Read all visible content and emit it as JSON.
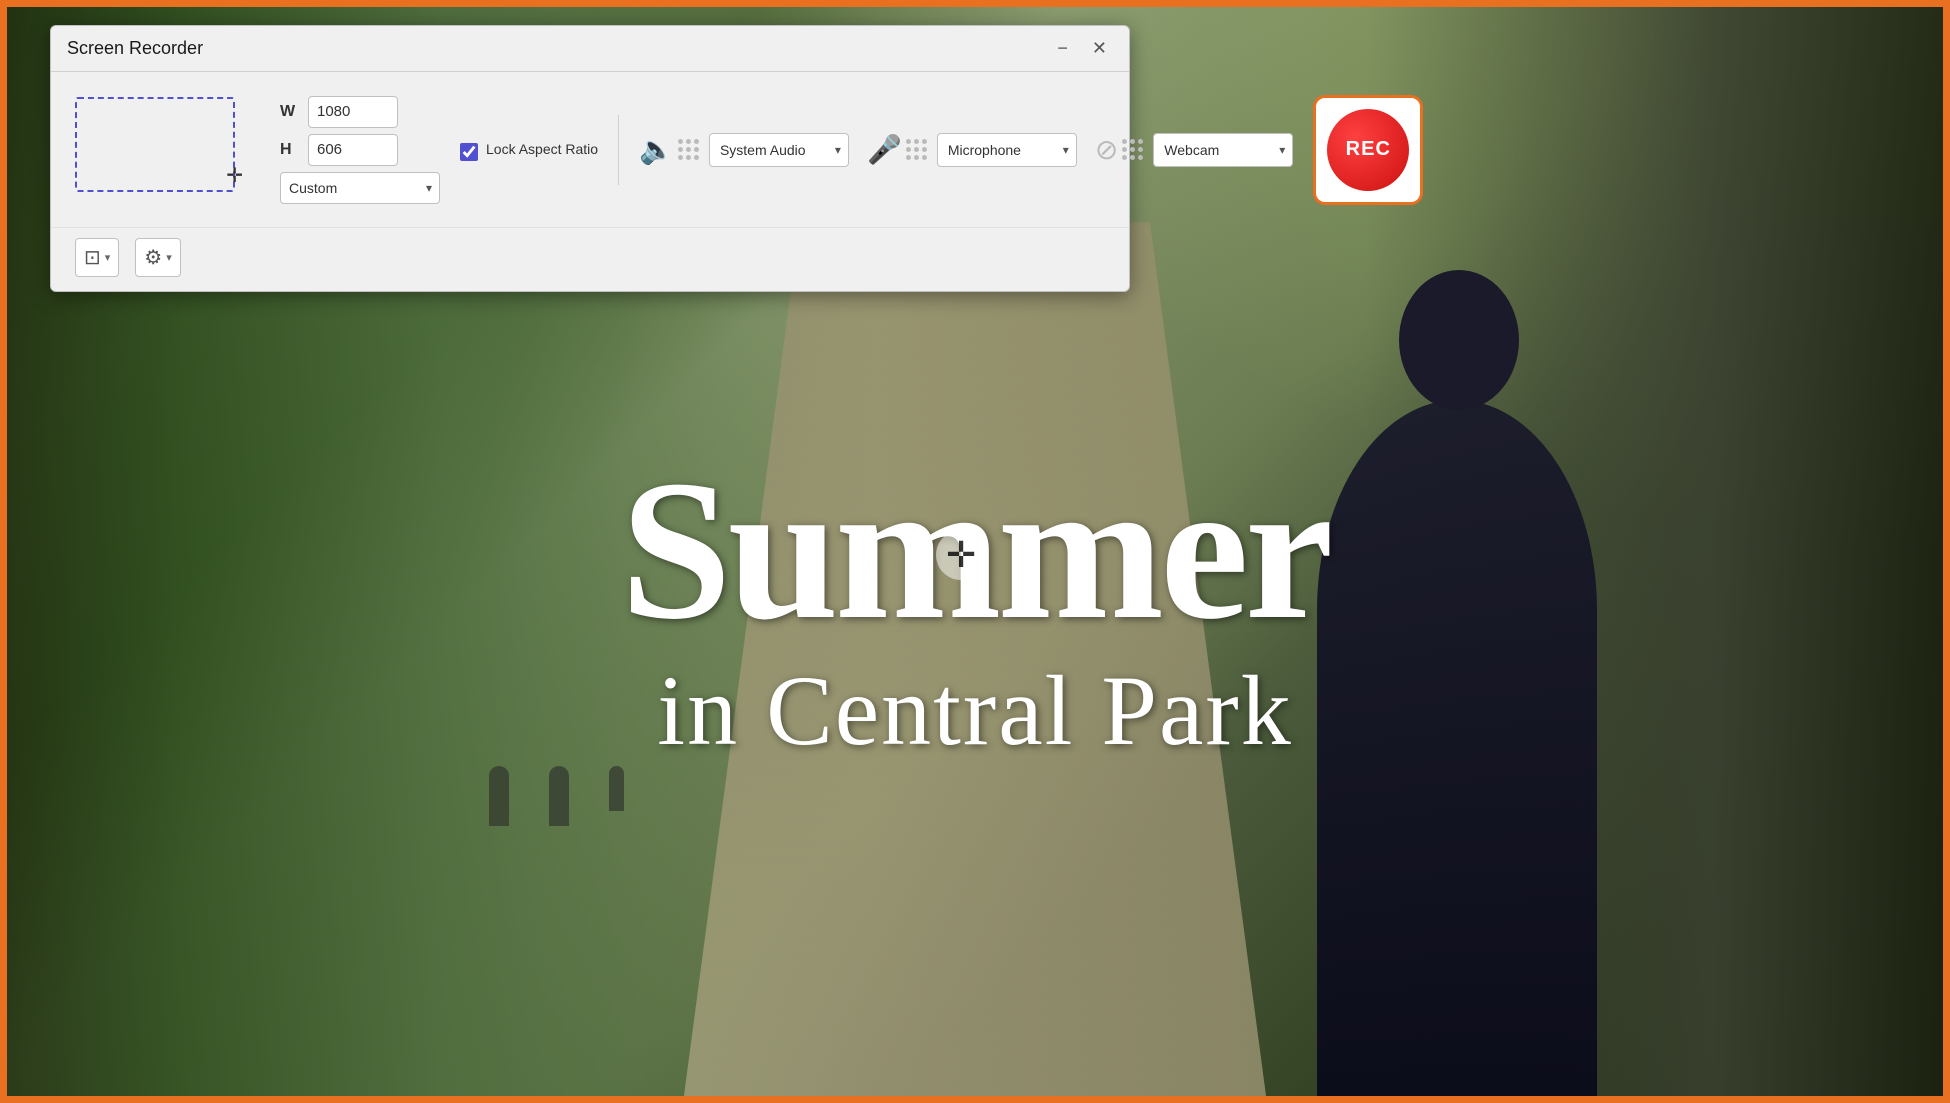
{
  "app": {
    "title": "Screen Recorder",
    "minimize_label": "−",
    "close_label": "✕"
  },
  "capture": {
    "width_label": "W",
    "height_label": "H",
    "width_value": "1080",
    "height_value": "606",
    "preset_label": "Custom",
    "lock_aspect_label": "Lock Aspect Ratio",
    "lock_checked": true
  },
  "audio": {
    "system_audio_label": "System Audio",
    "microphone_label": "Microphone",
    "webcam_label": "Webcam"
  },
  "record": {
    "button_label": "REC"
  },
  "toolbar": {
    "screen_capture_label": "Screen",
    "settings_label": "Settings"
  },
  "background": {
    "headline_line1": "Summer",
    "headline_line2": "in Central Park"
  },
  "colors": {
    "accent_orange": "#e87020",
    "selection_blue": "#5050d0",
    "rec_red": "#cc1010"
  }
}
